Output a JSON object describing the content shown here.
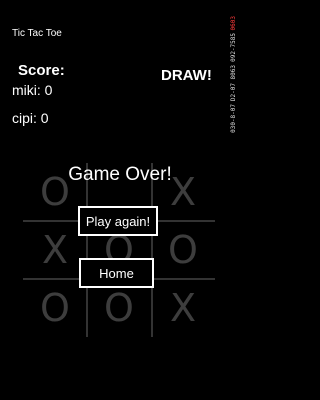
{
  "header": {
    "app_title": "Tic Tac Toe"
  },
  "score": {
    "title": "Score:",
    "player1": "miki: 0",
    "player2": "cipi: 0"
  },
  "result": "DRAW!",
  "status_strip": [
    "0603",
    "092-7585",
    "8063",
    "D2-07",
    "030-8-07"
  ],
  "board": {
    "cells": [
      "O",
      "",
      "X",
      "X",
      "",
      "",
      "",
      "",
      ""
    ],
    "cells_full": [
      [
        "O",
        "",
        "X"
      ],
      [
        "X",
        "O",
        "O"
      ],
      [
        "O",
        "O",
        "X"
      ]
    ]
  },
  "overlay": {
    "message": "Game Over!",
    "play_again_label": "Play again!",
    "home_label": "Home"
  }
}
